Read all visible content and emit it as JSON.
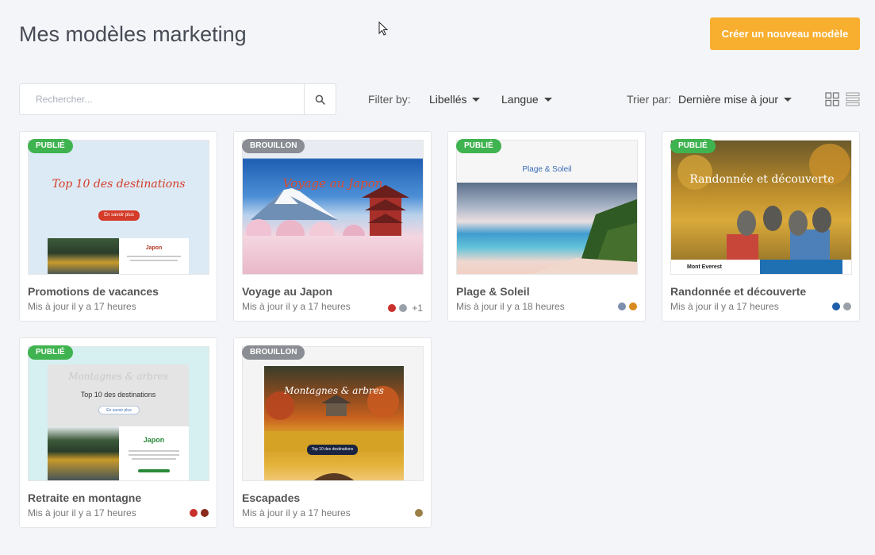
{
  "page": {
    "title": "Mes modèles marketing",
    "create_label": "Créer un nouveau modèle"
  },
  "search": {
    "placeholder": "Rechercher...",
    "icon": "search-icon"
  },
  "filters": {
    "label": "Filter by:",
    "labels_dropdown": "Libellés",
    "language_dropdown": "Langue"
  },
  "sort": {
    "label": "Trier par:",
    "value": "Dernière mise à jour"
  },
  "view_toggle": {
    "grid_icon": "grid-view-icon",
    "list_icon": "list-view-icon"
  },
  "cards": [
    {
      "status": "PUBLIÉ",
      "status_color": "#3fb34f",
      "title": "Promotions de vacances",
      "updated": "Mis à jour il y a 17 heures",
      "thumb": {
        "heading": "Top 10 des destinations",
        "button": "En savoir plus",
        "section": "Japon"
      },
      "tags": []
    },
    {
      "status": "BROUILLON",
      "status_color": "#8a8d93",
      "title": "Voyage au Japon",
      "updated": "Mis à jour il y a 17 heures",
      "thumb": {
        "heading": "Voyage au Japon"
      },
      "tags": [
        "#c9302c",
        "#9aa0a8"
      ],
      "more": "+1"
    },
    {
      "status": "PUBLIÉ",
      "status_color": "#3fb34f",
      "title": "Plage & Soleil",
      "updated": "Mis à jour il y a 18 heures",
      "thumb": {
        "heading": "Plage & Soleil"
      },
      "tags": [
        "#7d8fae",
        "#d98a1c"
      ]
    },
    {
      "status": "PUBLIÉ",
      "status_color": "#3fb34f",
      "title": "Randonnée et découverte",
      "updated": "Mis à jour il y a 17 heures",
      "thumb": {
        "heading": "Randonnée et découverte",
        "section": "Mont Everest"
      },
      "tags": [
        "#1f5ea8",
        "#9aa0a8"
      ]
    },
    {
      "status": "PUBLIÉ",
      "status_color": "#3fb34f",
      "title": "Retraite en montagne",
      "updated": "Mis à jour il y a 17 heures",
      "thumb": {
        "script": "Montagnes & arbres",
        "heading": "Top 10 des destinations",
        "button": "En savoir plus",
        "section": "Japon"
      },
      "tags": [
        "#c9302c",
        "#8a2a1c"
      ]
    },
    {
      "status": "BROUILLON",
      "status_color": "#8a8d93",
      "title": "Escapades",
      "updated": "Mis à jour il y a 17 heures",
      "thumb": {
        "heading": "Montagnes & arbres",
        "button": "Top 10 des destinations"
      },
      "tags": [
        "#9b7f45"
      ]
    }
  ]
}
